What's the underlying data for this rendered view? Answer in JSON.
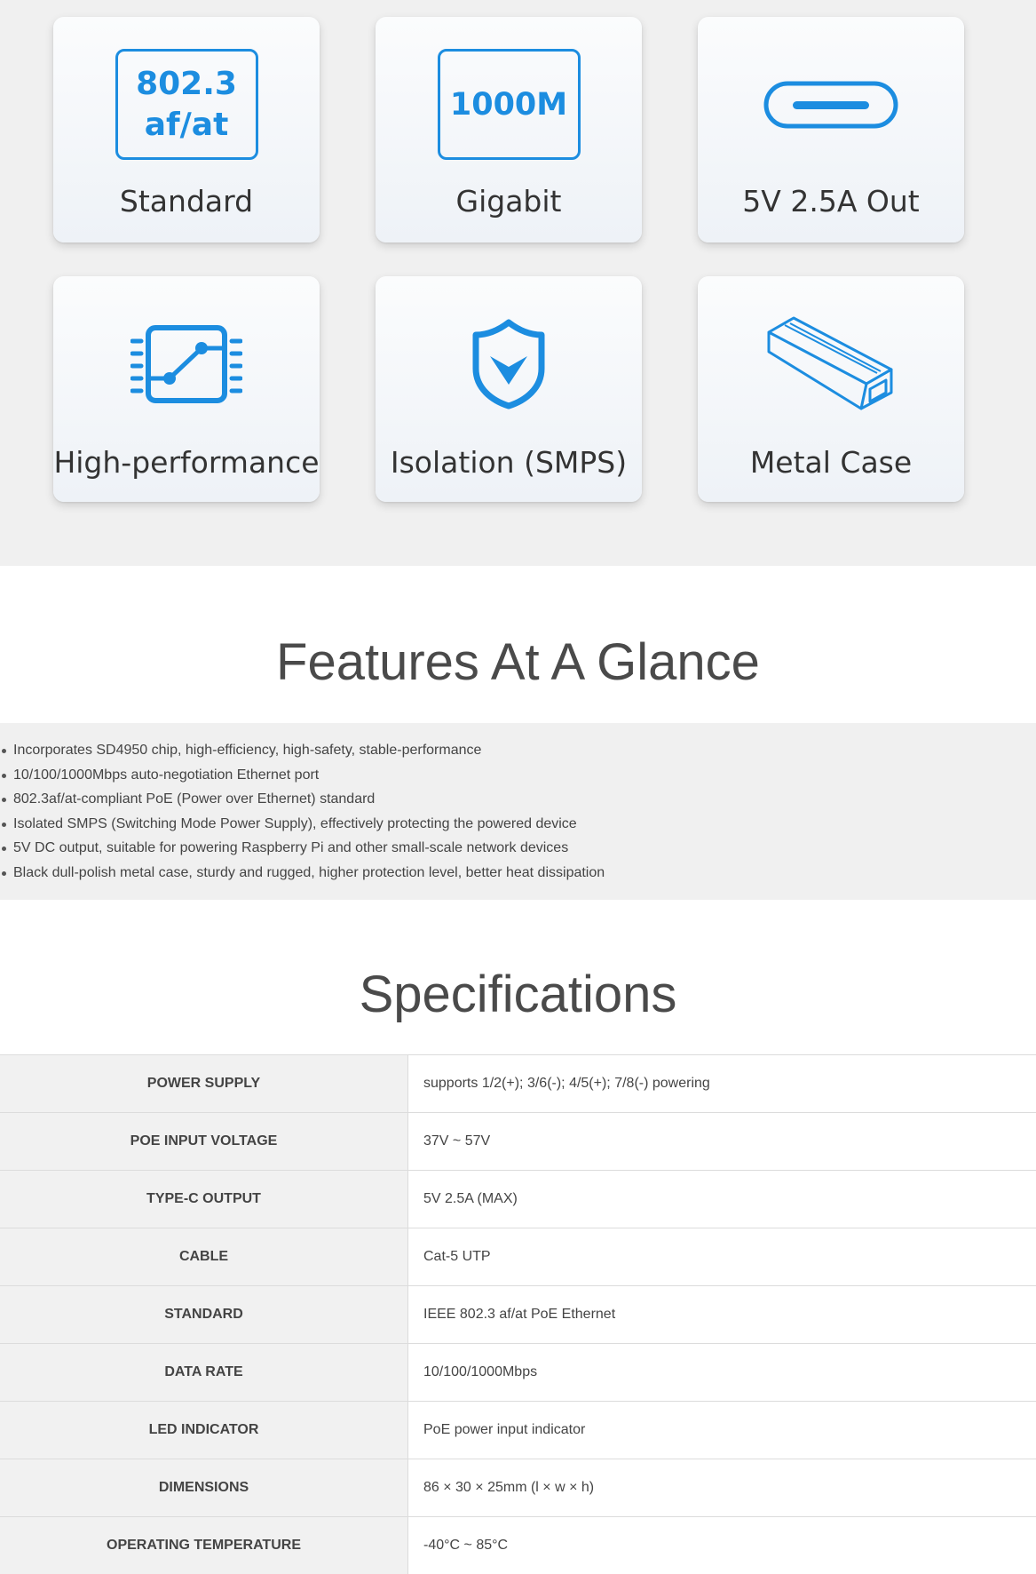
{
  "feature_cards": [
    {
      "icon": "802.3 af/at standard box",
      "icon_text": [
        "802.3",
        "af/at"
      ],
      "label": "Standard"
    },
    {
      "icon": "1000M gigabit box",
      "icon_text": [
        "1000M"
      ],
      "label": "Gigabit"
    },
    {
      "icon": "usb-c-port-icon",
      "label": "5V 2.5A Out"
    },
    {
      "icon": "chip-circuit-icon",
      "label": "High-performance"
    },
    {
      "icon": "shield-check-icon",
      "label": "Isolation (SMPS)"
    },
    {
      "icon": "metal-case-icon",
      "label": "Metal Case"
    }
  ],
  "features": {
    "title": "Features At A Glance",
    "items": [
      "Incorporates SD4950 chip, high-efficiency, high-safety, stable-performance",
      "10/100/1000Mbps auto-negotiation Ethernet port",
      "802.3af/at-compliant PoE (Power over Ethernet) standard",
      "Isolated SMPS (Switching Mode Power Supply), effectively protecting the powered device",
      "5V DC output, suitable for powering Raspberry Pi and other small-scale network devices",
      "Black dull-polish metal case, sturdy and rugged, higher protection level, better heat dissipation"
    ]
  },
  "specifications": {
    "title": "Specifications",
    "rows": [
      {
        "key": "POWER SUPPLY",
        "value": "supports 1/2(+); 3/6(-); 4/5(+); 7/8(-) powering"
      },
      {
        "key": "POE INPUT VOLTAGE",
        "value": "37V ~ 57V"
      },
      {
        "key": "TYPE-C OUTPUT",
        "value": "5V 2.5A (MAX)"
      },
      {
        "key": "CABLE",
        "value": "Cat-5 UTP"
      },
      {
        "key": "STANDARD",
        "value": "IEEE 802.3 af/at PoE Ethernet"
      },
      {
        "key": "DATA RATE",
        "value": "10/100/1000Mbps"
      },
      {
        "key": "LED INDICATOR",
        "value": "PoE power input indicator"
      },
      {
        "key": "DIMENSIONS",
        "value": "86 × 30 × 25mm (l × w × h)"
      },
      {
        "key": "OPERATING TEMPERATURE",
        "value": "-40°C ~ 85°C"
      }
    ]
  },
  "colors": {
    "accent": "#1c8de0",
    "hero_bg": "#f0f0f0",
    "key_cell_bg": "#f1f1f1"
  }
}
